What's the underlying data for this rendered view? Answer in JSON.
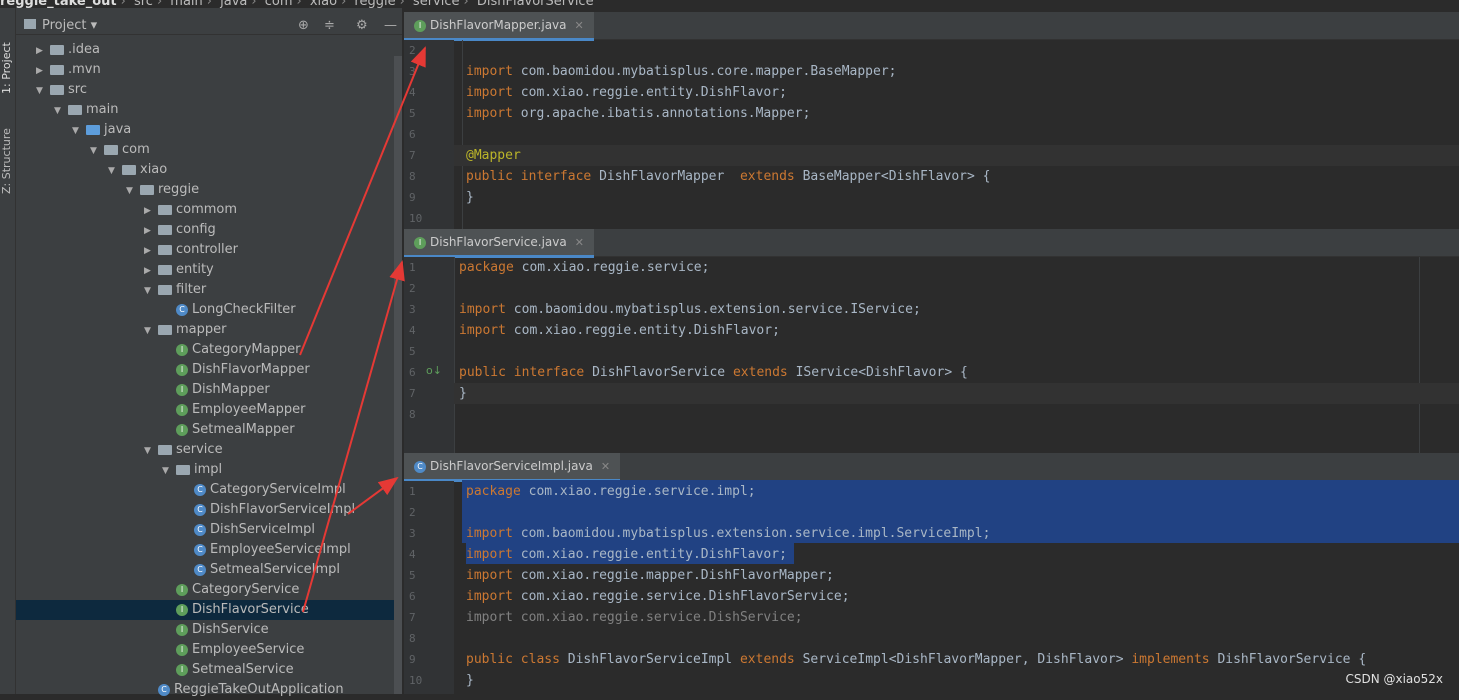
{
  "breadcrumb": {
    "items": [
      "reggie_take_out",
      "src",
      "main",
      "java",
      "com",
      "xiao",
      "reggie",
      "service",
      "DishFlavorService"
    ]
  },
  "left_tabs": {
    "project": "1: Project",
    "structure": "Z: Structure"
  },
  "project_panel": {
    "title": "Project",
    "tree": [
      {
        "label": ".idea",
        "icon": "folder"
      },
      {
        "label": ".mvn",
        "icon": "folder"
      },
      {
        "label": "src",
        "icon": "folder"
      },
      {
        "label": "main",
        "icon": "folder"
      },
      {
        "label": "java",
        "icon": "folder-blue"
      },
      {
        "label": "com",
        "icon": "package"
      },
      {
        "label": "xiao",
        "icon": "package"
      },
      {
        "label": "reggie",
        "icon": "package"
      },
      {
        "label": "commom",
        "icon": "package"
      },
      {
        "label": "config",
        "icon": "package"
      },
      {
        "label": "controller",
        "icon": "package"
      },
      {
        "label": "entity",
        "icon": "package"
      },
      {
        "label": "filter",
        "icon": "package"
      },
      {
        "label": "LongCheckFilter",
        "icon": "class"
      },
      {
        "label": "mapper",
        "icon": "package"
      },
      {
        "label": "CategoryMapper",
        "icon": "interface"
      },
      {
        "label": "DishFlavorMapper",
        "icon": "interface"
      },
      {
        "label": "DishMapper",
        "icon": "interface"
      },
      {
        "label": "EmployeeMapper",
        "icon": "interface"
      },
      {
        "label": "SetmealMapper",
        "icon": "interface"
      },
      {
        "label": "service",
        "icon": "package"
      },
      {
        "label": "impl",
        "icon": "package"
      },
      {
        "label": "CategoryServiceImpl",
        "icon": "class"
      },
      {
        "label": "DishFlavorServiceImpl",
        "icon": "class"
      },
      {
        "label": "DishServiceImpl",
        "icon": "class"
      },
      {
        "label": "EmployeeServiceImpl",
        "icon": "class"
      },
      {
        "label": "SetmealServiceImpl",
        "icon": "class"
      },
      {
        "label": "CategoryService",
        "icon": "interface"
      },
      {
        "label": "DishFlavorService",
        "icon": "interface"
      },
      {
        "label": "DishService",
        "icon": "interface"
      },
      {
        "label": "EmployeeService",
        "icon": "interface"
      },
      {
        "label": "SetmealService",
        "icon": "interface"
      },
      {
        "label": "ReggieTakeOutApplication",
        "icon": "class"
      }
    ]
  },
  "editors": [
    {
      "tab": "DishFlavorMapper.java",
      "lines": [
        {
          "n": "2",
          "t": ""
        },
        {
          "n": "3",
          "t": "import com.baomidou.mybatisplus.core.mapper.BaseMapper;"
        },
        {
          "n": "4",
          "t": "import com.xiao.reggie.entity.DishFlavor;"
        },
        {
          "n": "5",
          "t": "import org.apache.ibatis.annotations.Mapper;"
        },
        {
          "n": "6",
          "t": ""
        },
        {
          "n": "7",
          "t": "@Mapper"
        },
        {
          "n": "8",
          "t": "public interface DishFlavorMapper  extends BaseMapper<DishFlavor> {"
        },
        {
          "n": "9",
          "t": "}"
        },
        {
          "n": "10",
          "t": ""
        }
      ]
    },
    {
      "tab": "DishFlavorService.java",
      "lines": [
        {
          "n": "1",
          "t": "package com.xiao.reggie.service;"
        },
        {
          "n": "2",
          "t": ""
        },
        {
          "n": "3",
          "t": "import com.baomidou.mybatisplus.extension.service.IService;"
        },
        {
          "n": "4",
          "t": "import com.xiao.reggie.entity.DishFlavor;"
        },
        {
          "n": "5",
          "t": ""
        },
        {
          "n": "6",
          "t": "public interface DishFlavorService extends IService<DishFlavor> {"
        },
        {
          "n": "7",
          "t": "}"
        },
        {
          "n": "8",
          "t": ""
        }
      ]
    },
    {
      "tab": "DishFlavorServiceImpl.java",
      "lines": [
        {
          "n": "1",
          "t": "package com.xiao.reggie.service.impl;"
        },
        {
          "n": "2",
          "t": ""
        },
        {
          "n": "3",
          "t": "import com.baomidou.mybatisplus.extension.service.impl.ServiceImpl;"
        },
        {
          "n": "4",
          "t": "import com.xiao.reggie.entity.DishFlavor;"
        },
        {
          "n": "5",
          "t": "import com.xiao.reggie.mapper.DishFlavorMapper;"
        },
        {
          "n": "6",
          "t": "import com.xiao.reggie.service.DishFlavorService;"
        },
        {
          "n": "7",
          "t": "import com.xiao.reggie.service.DishService;"
        },
        {
          "n": "8",
          "t": ""
        },
        {
          "n": "9",
          "t": "public class DishFlavorServiceImpl extends ServiceImpl<DishFlavorMapper, DishFlavor> implements DishFlavorService {"
        },
        {
          "n": "10",
          "t": "}"
        }
      ]
    }
  ],
  "watermark": "CSDN @xiao52x",
  "colors": {
    "keyword": "#cc7832",
    "annotation": "#bbb529",
    "text": "#a9b7c6",
    "selection": "#214283",
    "arrow": "#e53935"
  }
}
